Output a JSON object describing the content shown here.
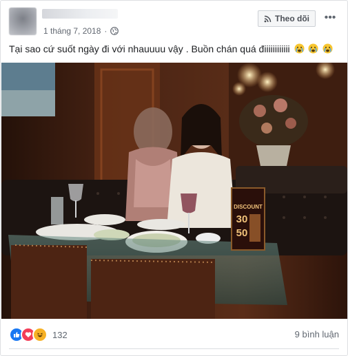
{
  "post": {
    "date": "1 tháng 7, 2018",
    "follow_label": "Theo dõi",
    "more_label": "•••",
    "text": "Tại sao cứ suốt ngày đi với nhauuuu vậy . Buồn chán quá điiiiiiiiiiii"
  },
  "photo": {
    "sign_title": "DISCOUNT",
    "sign_value_1": "30",
    "sign_value_2": "50"
  },
  "reactions": {
    "count": "132",
    "comments_label": "9 bình luận",
    "colors": {
      "like": "#1877f2",
      "love": "#f33e58",
      "haha": "#f7b125"
    }
  },
  "icons": [
    "globe-icon",
    "rss-icon",
    "more-icon",
    "crying-emoji-icon",
    "like-icon",
    "love-icon",
    "haha-icon"
  ]
}
